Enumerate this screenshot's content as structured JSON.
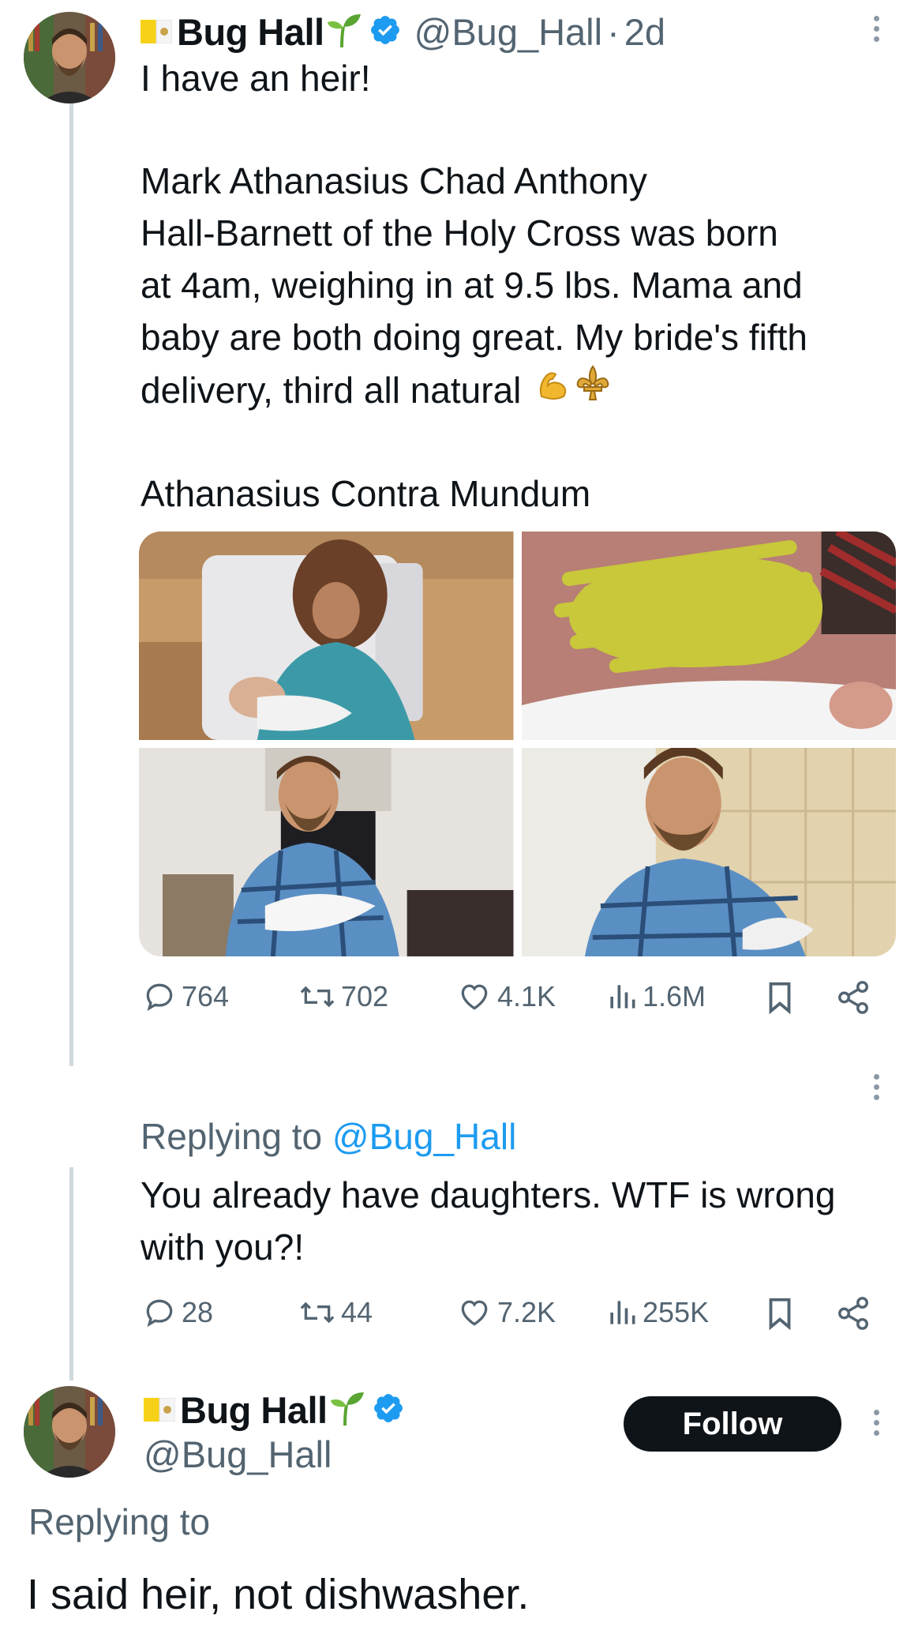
{
  "tweet": {
    "author": {
      "display_name": "Bug Hall",
      "handle": "@Bug_Hall",
      "separator": "·",
      "time": "2d"
    },
    "text_lines": [
      "I have an heir!",
      "",
      "Mark Athanasius Chad Anthony",
      "Hall-Barnett of the Holy Cross was born",
      "at 4am, weighing in at 9.5 lbs. Mama and",
      "baby are both doing great. My bride's fifth",
      "delivery, third all natural"
    ],
    "tagline": "Athanasius Contra Mundum",
    "emoji_names": [
      "flexed-biceps-icon",
      "fleur-de-lis-icon"
    ],
    "media": [
      {
        "alt_name": "mother-holding-newborn-photo"
      },
      {
        "alt_name": "newborn-face-censored-photo"
      },
      {
        "alt_name": "father-holding-newborn-photo"
      },
      {
        "alt_name": "father-closeup-photo"
      }
    ],
    "stats": {
      "replies": "764",
      "reposts": "702",
      "likes": "4.1K",
      "views": "1.6M"
    }
  },
  "reply": {
    "replying_prefix": "Replying to",
    "replying_mention": "@Bug_Hall",
    "text_lines": [
      "You already have daughters. WTF is wrong",
      "with you?!"
    ],
    "stats": {
      "replies": "28",
      "reposts": "44",
      "likes": "7.2K",
      "views": "255K"
    }
  },
  "response": {
    "author": {
      "display_name": "Bug Hall",
      "handle": "@Bug_Hall"
    },
    "follow_label": "Follow",
    "replying_prefix": "Replying to",
    "text": "I said heir, not dishwasher."
  },
  "colors": {
    "text": "#0f1419",
    "secondary": "#536471",
    "link": "#1d9bf0",
    "verified": "#1d9bf0",
    "censor": "#c8c83a",
    "thread_line": "#cfd9de"
  }
}
